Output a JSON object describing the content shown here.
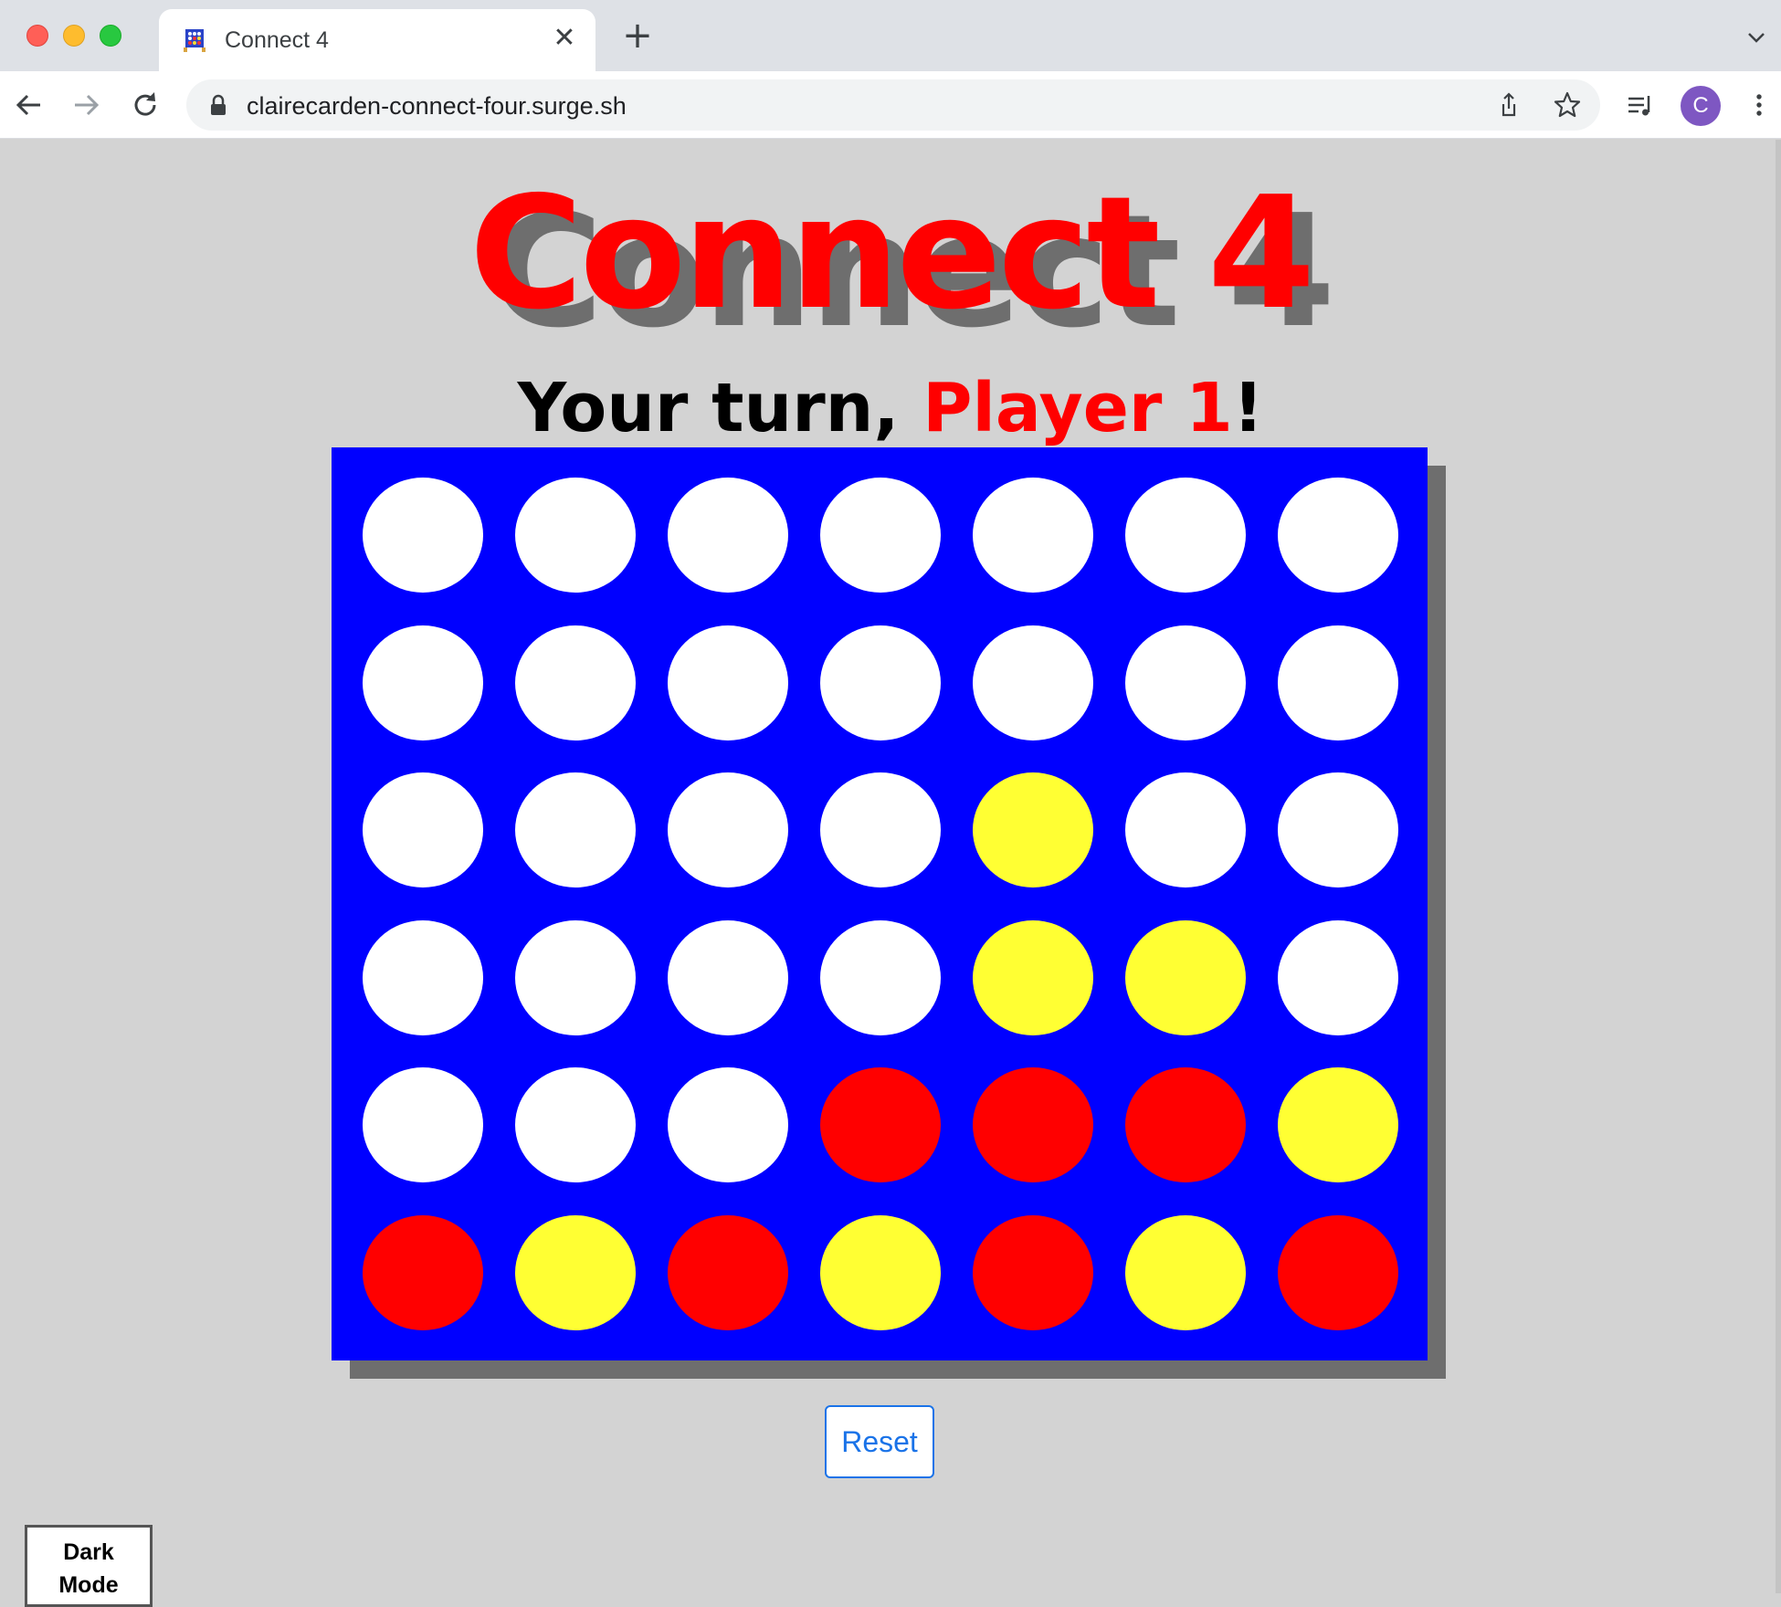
{
  "browser": {
    "tab_title": "Connect 4",
    "url": "clairecarden-connect-four.surge.sh",
    "profile_initial": "C"
  },
  "game": {
    "title": "Connect 4",
    "turn_prefix": "Your turn, ",
    "turn_player": "Player 1",
    "turn_suffix": "!",
    "colors": {
      "board": "#0000ff",
      "empty": "#ffffff",
      "R": "#ff0000",
      "Y": "#ffff33"
    },
    "board": [
      [
        "E",
        "E",
        "E",
        "E",
        "E",
        "E",
        "E"
      ],
      [
        "E",
        "E",
        "E",
        "E",
        "E",
        "E",
        "E"
      ],
      [
        "E",
        "E",
        "E",
        "E",
        "Y",
        "E",
        "E"
      ],
      [
        "E",
        "E",
        "E",
        "E",
        "Y",
        "Y",
        "E"
      ],
      [
        "E",
        "E",
        "E",
        "R",
        "R",
        "R",
        "Y"
      ],
      [
        "R",
        "Y",
        "R",
        "Y",
        "R",
        "Y",
        "R"
      ]
    ]
  },
  "controls": {
    "reset_label": "Reset",
    "dark_mode_line1": "Dark",
    "dark_mode_line2": "Mode"
  }
}
